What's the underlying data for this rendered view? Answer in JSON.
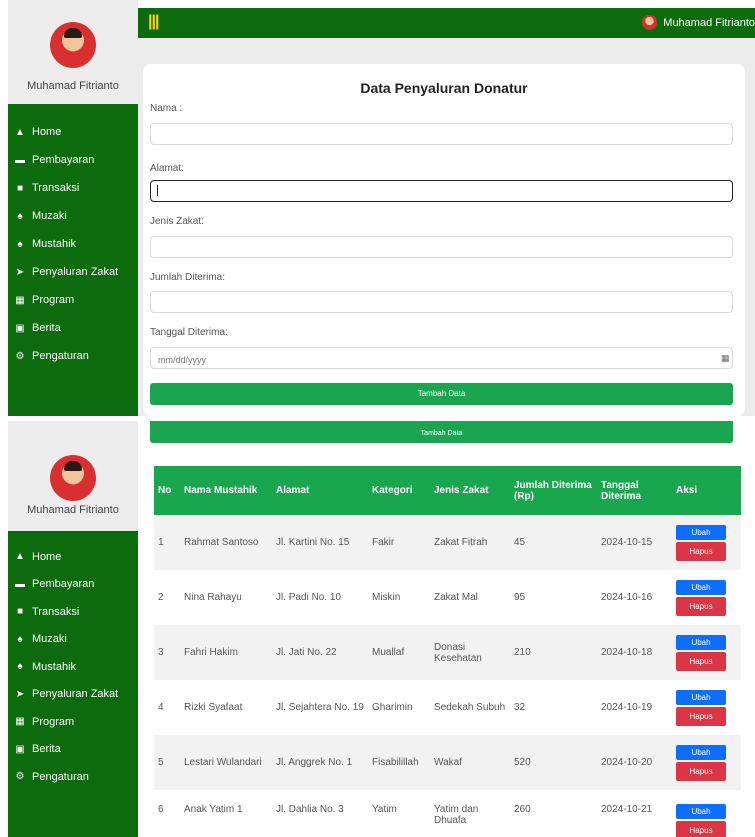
{
  "user": {
    "name": "Muhamad Fitrianto"
  },
  "sidebar": {
    "items": [
      {
        "label": "Home",
        "icon": "home-icon"
      },
      {
        "label": "Pembayaran",
        "icon": "credit-card-icon"
      },
      {
        "label": "Transaksi",
        "icon": "money-icon"
      },
      {
        "label": "Muzaki",
        "icon": "users-icon"
      },
      {
        "label": "Mustahik",
        "icon": "user-group-icon"
      },
      {
        "label": "Penyaluran Zakat",
        "icon": "send-icon"
      },
      {
        "label": "Program",
        "icon": "list-icon"
      },
      {
        "label": "Berita",
        "icon": "newspaper-icon"
      },
      {
        "label": "Pengaturan",
        "icon": "gear-icon"
      }
    ]
  },
  "topbar": {
    "menu_icon": "hamburger-icon",
    "user_name": "Muhamad Fitrianto"
  },
  "form": {
    "title": "Data Penyaluran Donatur",
    "nama_label": "Nama :",
    "alamat_label": "Alamat:",
    "jenis_label": "Jenis Zakat:",
    "jumlah_label": "Jumlah Diterima:",
    "tanggal_label": "Tanggal Diterima:",
    "tanggal_placeholder": "mm/dd/yyyy",
    "submit_label": "Tambah Data"
  },
  "table": {
    "headers": [
      "No",
      "Nama Mustahik",
      "Alamat",
      "Kategori",
      "Jenis Zakat",
      "Jumlah Diterima (Rp)",
      "Tanggal Diterima",
      "Aksi"
    ],
    "rows": [
      {
        "no": "1",
        "nama": "Rahmat Santoso",
        "alamat": "Jl. Kartini No. 15",
        "kategori": "Fakir",
        "jenis": "Zakat Fitrah",
        "jumlah": "45",
        "tanggal": "2024-10-15"
      },
      {
        "no": "2",
        "nama": "Nina Rahayu",
        "alamat": "Jl. Padi No. 10",
        "kategori": "Miskin",
        "jenis": "Zakat Mal",
        "jumlah": "95",
        "tanggal": "2024-10-16"
      },
      {
        "no": "3",
        "nama": "Fahri Hakim",
        "alamat": "Jl. Jati No. 22",
        "kategori": "Muallaf",
        "jenis": "Donasi Kesehatan",
        "jumlah": "210",
        "tanggal": "2024-10-18"
      },
      {
        "no": "4",
        "nama": "Rizki Syafaat",
        "alamat": "Jl. Sejahtera No. 19",
        "kategori": "Gharimin",
        "jenis": "Sedekah Subuh",
        "jumlah": "32",
        "tanggal": "2024-10-19"
      },
      {
        "no": "5",
        "nama": "Lestari Wulandari",
        "alamat": "Jl. Anggrek No. 1",
        "kategori": "Fisabilillah",
        "jenis": "Wakaf",
        "jumlah": "520",
        "tanggal": "2024-10-20"
      },
      {
        "no": "6",
        "nama": "Anak Yatim 1",
        "alamat": "Jl. Dahlia No. 3",
        "kategori": "Yatim",
        "jenis": "Yatim dan Dhuafa",
        "jumlah": "260",
        "tanggal": "2024-10-21"
      }
    ],
    "ubah_label": "Ubah",
    "hapus_label": "Hapus"
  }
}
